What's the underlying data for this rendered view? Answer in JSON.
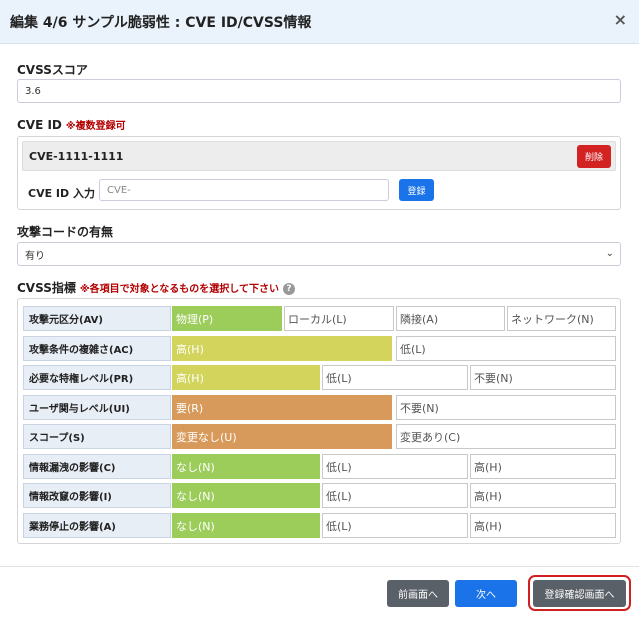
{
  "header": {
    "title": "編集 4/6 サンプル脆弱性 : CVE ID/CVSS情報",
    "close": "×"
  },
  "cvss_score": {
    "label": "CVSSスコア",
    "value": "3.6"
  },
  "cve": {
    "label": "CVE ID",
    "note": "※複数登録可",
    "entries": [
      {
        "value": "CVE-1111-1111",
        "delete_label": "削除"
      }
    ],
    "input_label": "CVE ID 入力",
    "input_placeholder": "CVE-",
    "register_label": "登録"
  },
  "attack_code": {
    "label": "攻撃コードの有無",
    "selected": "有り"
  },
  "cvss_metrics": {
    "label": "CVSS指標",
    "note": "※各項目で対象となるものを選択して下さい",
    "help": "?",
    "rows": [
      {
        "label": "攻撃元区分(AV)",
        "options": [
          "物理(P)",
          "ローカル(L)",
          "隣接(A)",
          "ネットワーク(N)"
        ],
        "selected": 0,
        "color": "#9ccc5a"
      },
      {
        "label": "攻撃条件の複雑さ(AC)",
        "options": [
          "高(H)",
          "低(L)"
        ],
        "selected": 0,
        "color": "#d3d45c"
      },
      {
        "label": "必要な特権レベル(PR)",
        "options": [
          "高(H)",
          "低(L)",
          "不要(N)"
        ],
        "selected": 0,
        "color": "#d3d45c"
      },
      {
        "label": "ユーザ関与レベル(UI)",
        "options": [
          "要(R)",
          "不要(N)"
        ],
        "selected": 0,
        "color": "#d89a5a"
      },
      {
        "label": "スコープ(S)",
        "options": [
          "変更なし(U)",
          "変更あり(C)"
        ],
        "selected": 0,
        "color": "#d89a5a"
      },
      {
        "label": "情報漏洩の影響(C)",
        "options": [
          "なし(N)",
          "低(L)",
          "高(H)"
        ],
        "selected": 0,
        "color": "#9ccc5a"
      },
      {
        "label": "情報改竄の影響(I)",
        "options": [
          "なし(N)",
          "低(L)",
          "高(H)"
        ],
        "selected": 0,
        "color": "#9ccc5a"
      },
      {
        "label": "業務停止の影響(A)",
        "options": [
          "なし(N)",
          "低(L)",
          "高(H)"
        ],
        "selected": 0,
        "color": "#9ccc5a"
      }
    ]
  },
  "footer": {
    "prev_label": "前画面へ",
    "next_label": "次へ",
    "confirm_label": "登録確認画面へ"
  }
}
